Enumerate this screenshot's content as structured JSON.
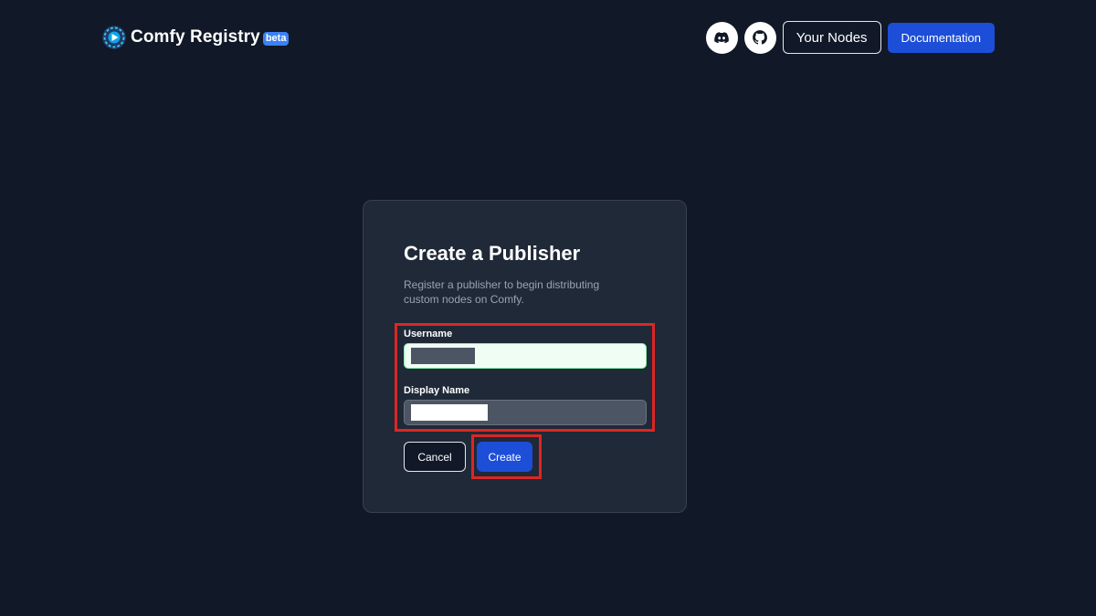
{
  "header": {
    "logo_icon": "comfy-logo-icon",
    "brand_name": "Comfy Registry",
    "beta_label": "beta",
    "discord_icon": "discord-icon",
    "github_icon": "github-icon",
    "your_nodes_label": "Your Nodes",
    "documentation_label": "Documentation"
  },
  "form": {
    "title": "Create a Publisher",
    "description": "Register a publisher to begin distributing custom nodes on Comfy.",
    "username_label": "Username",
    "display_name_label": "Display Name",
    "cancel_label": "Cancel",
    "create_label": "Create"
  },
  "colors": {
    "background": "#111827",
    "card": "#1f2937",
    "primary": "#1d4ed8",
    "highlight": "#dc2626"
  }
}
